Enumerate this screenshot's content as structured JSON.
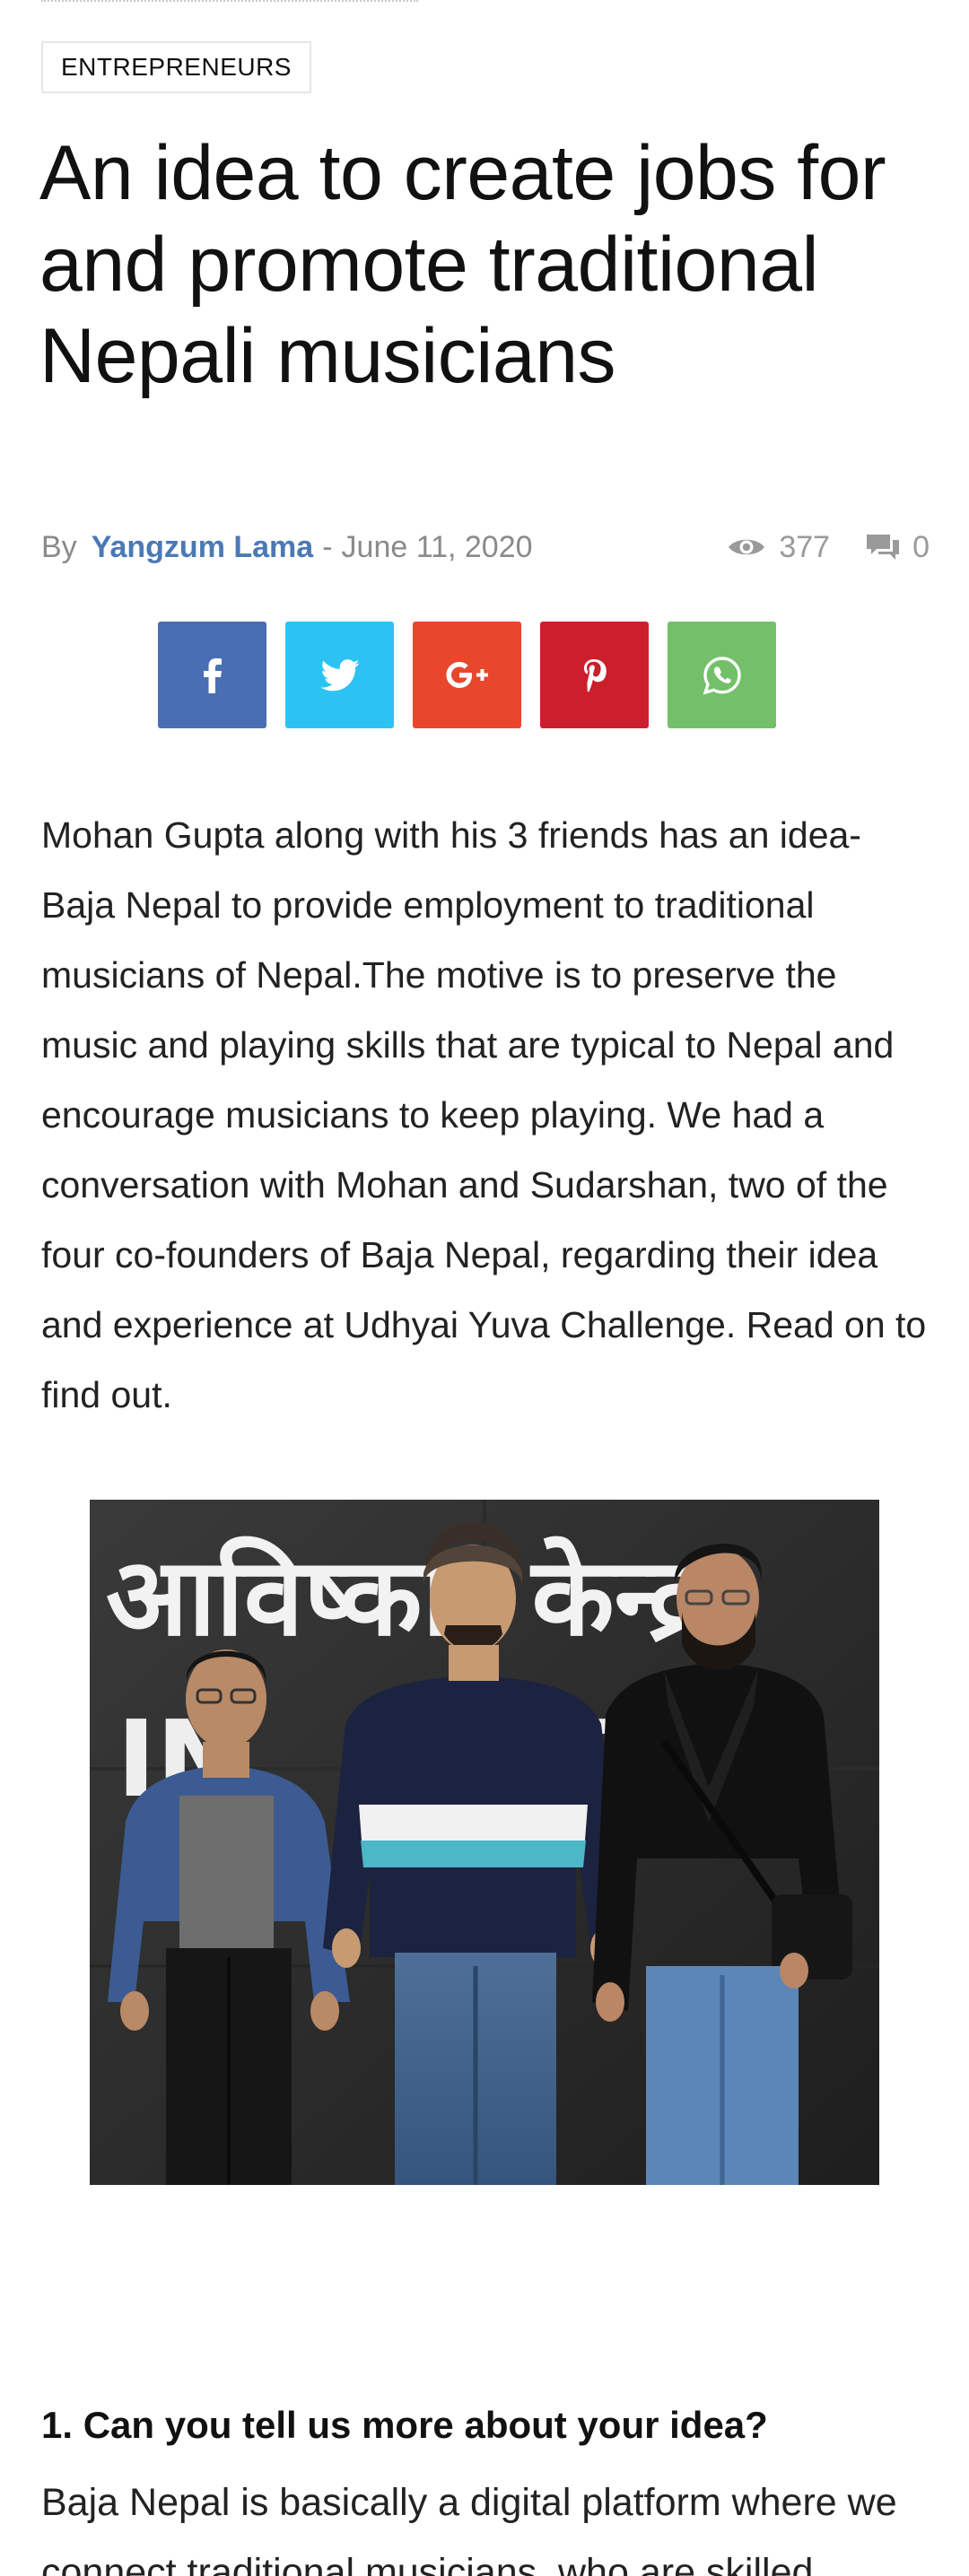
{
  "article": {
    "category": "ENTREPRENEURS",
    "title": "An idea to create jobs for and promote traditional Nepali musicians",
    "meta": {
      "by_label": "By",
      "author": "Yangzum Lama",
      "separator": "-",
      "date": "June 11, 2020",
      "views": "377",
      "comments": "0",
      "views_icon": "eye-icon",
      "comments_icon": "comment-icon"
    },
    "share": [
      {
        "network": "facebook",
        "icon": "facebook-icon",
        "color": "#4a6eb3"
      },
      {
        "network": "twitter",
        "icon": "twitter-icon",
        "color": "#2cc3f3"
      },
      {
        "network": "google-plus",
        "icon": "google-plus-icon",
        "color": "#e8472c"
      },
      {
        "network": "pinterest",
        "icon": "pinterest-icon",
        "color": "#cc1f2c"
      },
      {
        "network": "whatsapp",
        "icon": "whatsapp-icon",
        "color": "#74c06a"
      }
    ],
    "intro": "Mohan Gupta along with his 3 friends has an idea- Baja Nepal to provide employment to traditional musicians of Nepal.The motive is to preserve the music and playing skills that are typical to Nepal and encourage musicians to keep playing. We had a conversation with Mohan and Sudarshan, two of the four co-founders of Baja Nepal, regarding their idea and experience at Udhyai Yuva Challenge. Read on to find out.",
    "photo": {
      "sign_devanagari": "आविष्कार केन्द्र",
      "sign_latin": "IN        TE"
    },
    "question_1": "1. Can you tell us more about your idea?",
    "answer_1": "Baja Nepal is basically a digital platform where we connect traditional musicians, who are skilled"
  },
  "colors": {
    "author_link": "#4a79b5",
    "meta_text": "#8a8a8a"
  }
}
